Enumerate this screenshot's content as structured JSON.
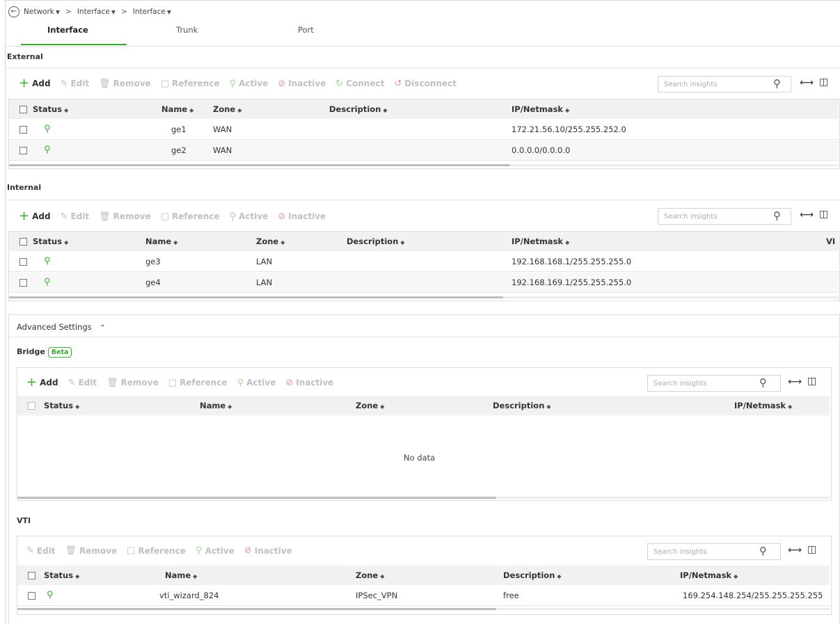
{
  "breadcrumb": {
    "items": [
      {
        "label": "Network"
      },
      {
        "label": "Interface"
      },
      {
        "label": "Interface"
      }
    ],
    "separator": ">"
  },
  "tabs": [
    {
      "label": "Interface",
      "active": true
    },
    {
      "label": "Trunk",
      "active": false
    },
    {
      "label": "Port",
      "active": false
    }
  ],
  "toolbar_labels": {
    "add": "Add",
    "edit": "Edit",
    "remove": "Remove",
    "reference": "Reference",
    "active": "Active",
    "inactive": "Inactive",
    "connect": "Connect",
    "disconnect": "Disconnect"
  },
  "search_placeholder": "Search insights",
  "external": {
    "title": "External",
    "columns": [
      "Status",
      "Name",
      "Zone",
      "Description",
      "IP/Netmask"
    ],
    "rows": [
      {
        "name": "ge1",
        "zone": "WAN",
        "description": "",
        "ip": "172.21.56.10/255.255.252.0"
      },
      {
        "name": "ge2",
        "zone": "WAN",
        "description": "",
        "ip": "0.0.0.0/0.0.0.0"
      }
    ]
  },
  "internal": {
    "title": "Internal",
    "columns": [
      "Status",
      "Name",
      "Zone",
      "Description",
      "IP/Netmask",
      "VI"
    ],
    "rows": [
      {
        "name": "ge3",
        "zone": "LAN",
        "description": "",
        "ip": "192.168.168.1/255.255.255.0"
      },
      {
        "name": "ge4",
        "zone": "LAN",
        "description": "",
        "ip": "192.168.169.1/255.255.255.0"
      }
    ]
  },
  "advanced": {
    "title": "Advanced Settings",
    "bridge": {
      "title": "Bridge",
      "badge": "Beta",
      "columns": [
        "Status",
        "Name",
        "Zone",
        "Description",
        "IP/Netmask"
      ],
      "empty_text": "No data"
    },
    "vti": {
      "title": "VTI",
      "columns": [
        "Status",
        "Name",
        "Zone",
        "Description",
        "IP/Netmask"
      ],
      "rows": [
        {
          "name": "vti_wizard_824",
          "zone": "IPSec_VPN",
          "description": "free",
          "ip": "169.254.148.254/255.255.255.255"
        }
      ]
    }
  },
  "colors": {
    "accent": "#3da935",
    "header_bg": "#f1f1f1"
  }
}
